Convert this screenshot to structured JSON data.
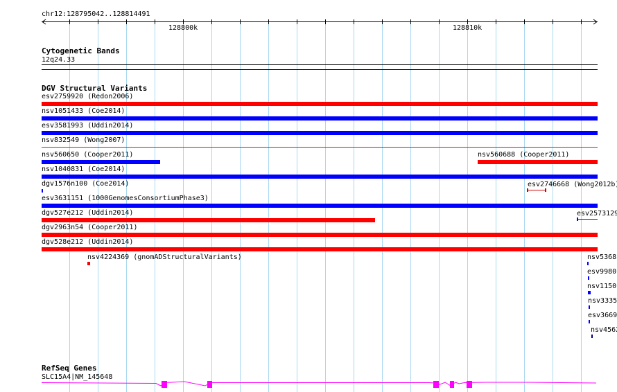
{
  "ruler": {
    "region": "chr12:128795042..128814491",
    "tick_labels": [
      "128800k",
      "128810k"
    ]
  },
  "cyto": {
    "title": "Cytogenetic Bands",
    "band": "12q24.33"
  },
  "dgv": {
    "title": "DGV Structural Variants",
    "colors": {
      "gain": "#ff0000",
      "loss": "#0000ff",
      "other": "#000000"
    },
    "labels": {
      "esv2759920": "esv2759920 (Redon2006)",
      "nsv1051433": "nsv1051433 (Coe2014)",
      "esv3581993": "esv3581993 (Uddin2014)",
      "nsv832549": "nsv832549 (Wong2007)",
      "nsv560650": "nsv560650 (Cooper2011)",
      "nsv560688": "nsv560688 (Cooper2011)",
      "nsv1040831": "nsv1040831 (Coe2014)",
      "dgv1576n100": "dgv1576n100 (Coe2014)",
      "esv2746668": "esv2746668 (Wong2012b)",
      "esv3631151": "esv3631151 (1000GenomesConsortiumPhase3)",
      "dgv527e212": "dgv527e212 (Uddin2014)",
      "esv2573129": "esv2573129",
      "dgv2963n54": "dgv2963n54 (Cooper2011)",
      "dgv528e212": "dgv528e212 (Uddin2014)",
      "nsv4224369": "nsv4224369 (gnomADStructuralVariants)",
      "nsv5368": "nsv5368",
      "esv9980": "esv9980",
      "nsv1150": "nsv1150",
      "nsv3335": "nsv3335",
      "esv3669": "esv3669",
      "nsv4562": "nsv4562"
    }
  },
  "refseq": {
    "title": "RefSeq Genes",
    "gene_label": "SLC15A4|NM_145648",
    "color": "#ff00ff"
  }
}
